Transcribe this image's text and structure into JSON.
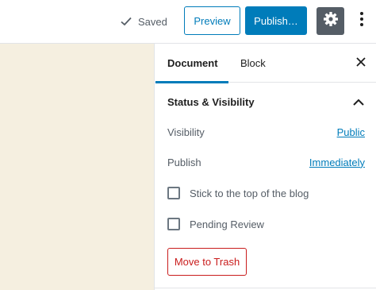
{
  "header": {
    "saved_label": "Saved",
    "preview_label": "Preview",
    "publish_label": "Publish…"
  },
  "sidebar": {
    "tabs": [
      {
        "label": "Document",
        "active": true
      },
      {
        "label": "Block",
        "active": false
      }
    ],
    "panel": {
      "title": "Status & Visibility",
      "expanded": true,
      "visibility": {
        "label": "Visibility",
        "value": "Public"
      },
      "publish": {
        "label": "Publish",
        "value": "Immediately"
      },
      "checkboxes": [
        {
          "label": "Stick to the top of the blog",
          "checked": false
        },
        {
          "label": "Pending Review",
          "checked": false
        }
      ],
      "trash_label": "Move to Trash"
    }
  },
  "colors": {
    "accent": "#007cba",
    "danger": "#c91c1c",
    "canvas_bg": "#f5efe0",
    "settings_active_bg": "#555d66"
  },
  "icons": [
    "check-icon",
    "gear-icon",
    "more-vertical-icon",
    "close-icon",
    "chevron-up-icon"
  ]
}
